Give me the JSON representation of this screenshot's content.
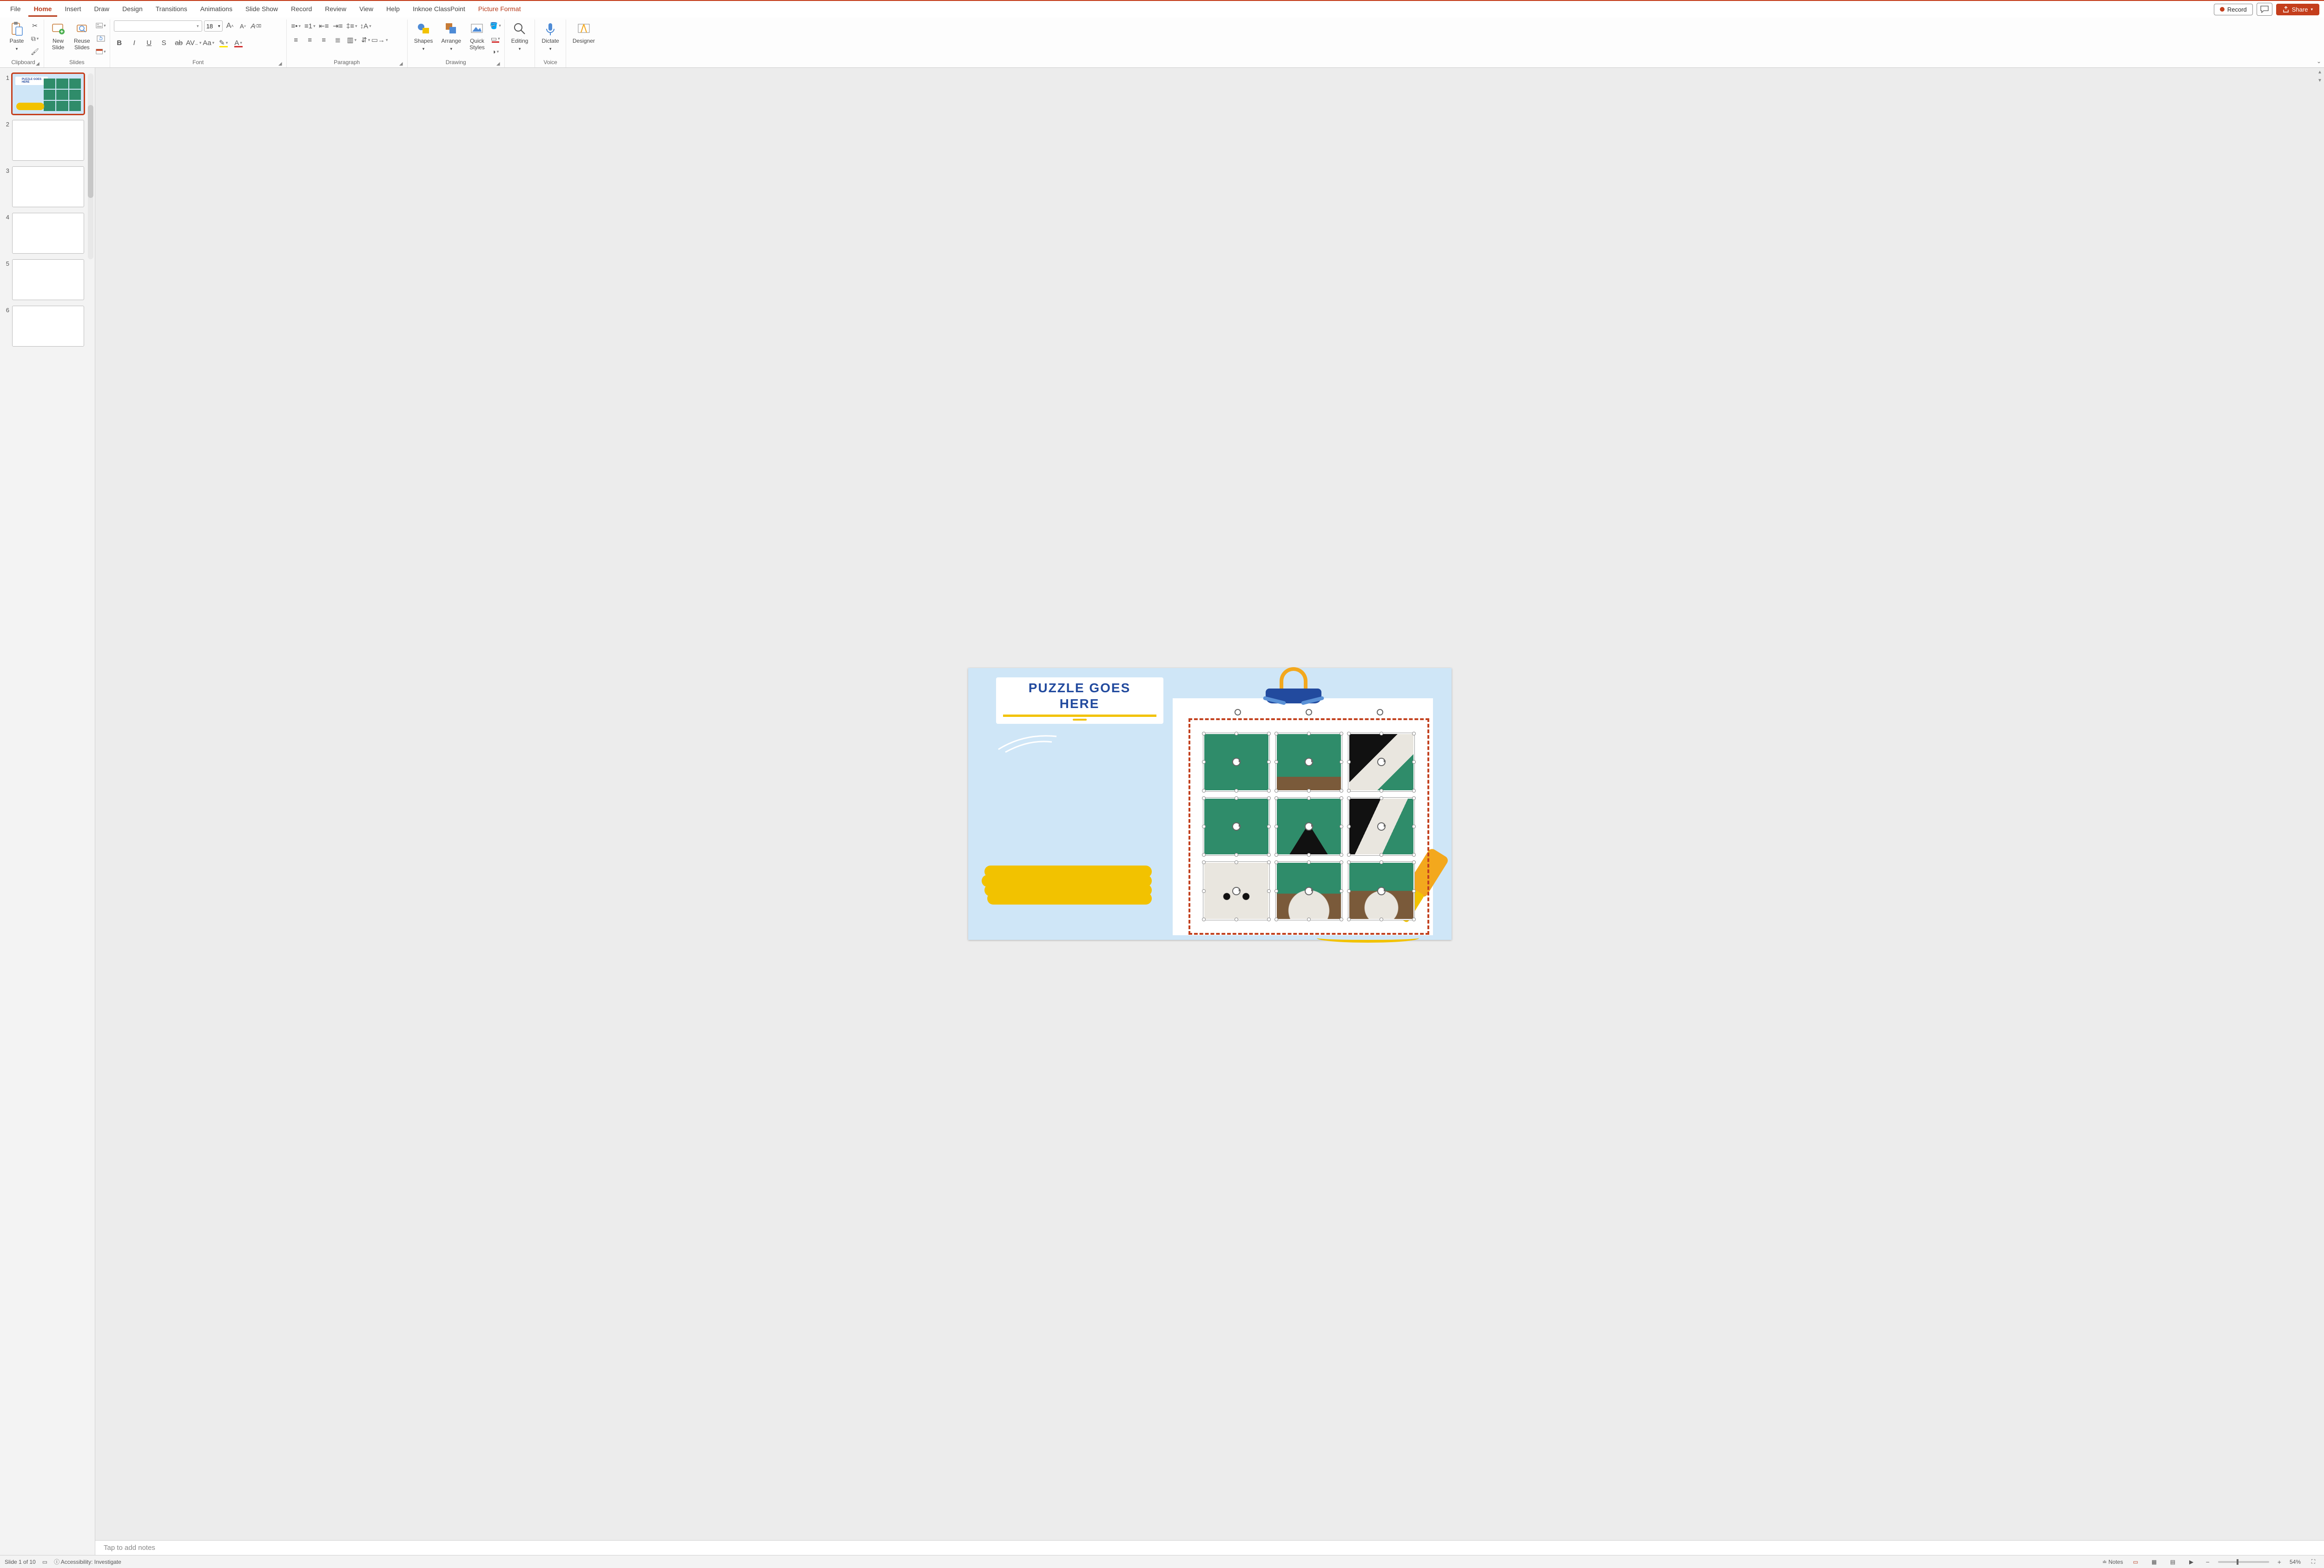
{
  "tabs": {
    "file": "File",
    "home": "Home",
    "insert": "Insert",
    "draw": "Draw",
    "design": "Design",
    "transitions": "Transitions",
    "animations": "Animations",
    "slideshow": "Slide Show",
    "record": "Record",
    "review": "Review",
    "view": "View",
    "help": "Help",
    "inknoe": "Inknoe ClassPoint",
    "picture_format": "Picture Format"
  },
  "tabs_right": {
    "record": "Record",
    "share": "Share"
  },
  "ribbon": {
    "clipboard": {
      "paste": "Paste",
      "label": "Clipboard"
    },
    "slides": {
      "new_slide": "New\nSlide",
      "reuse": "Reuse\nSlides",
      "label": "Slides"
    },
    "font": {
      "size": "18",
      "label": "Font",
      "case": "Aa"
    },
    "paragraph": {
      "label": "Paragraph"
    },
    "drawing": {
      "shapes": "Shapes",
      "arrange": "Arrange",
      "quick": "Quick\nStyles",
      "label": "Drawing"
    },
    "editing": {
      "label": "Editing"
    },
    "voice": {
      "dictate": "Dictate",
      "label": "Voice"
    },
    "designer": {
      "label": "Designer"
    }
  },
  "slide": {
    "title_line1": "PUZZLE GOES",
    "title_line2": "HERE"
  },
  "notes": {
    "placeholder": "Tap to add notes"
  },
  "status": {
    "slide_of": "Slide 1 of 10",
    "accessibility": "Accessibility: Investigate",
    "notes": "Notes",
    "zoom": "54%"
  },
  "thumbs": {
    "count": 6
  }
}
